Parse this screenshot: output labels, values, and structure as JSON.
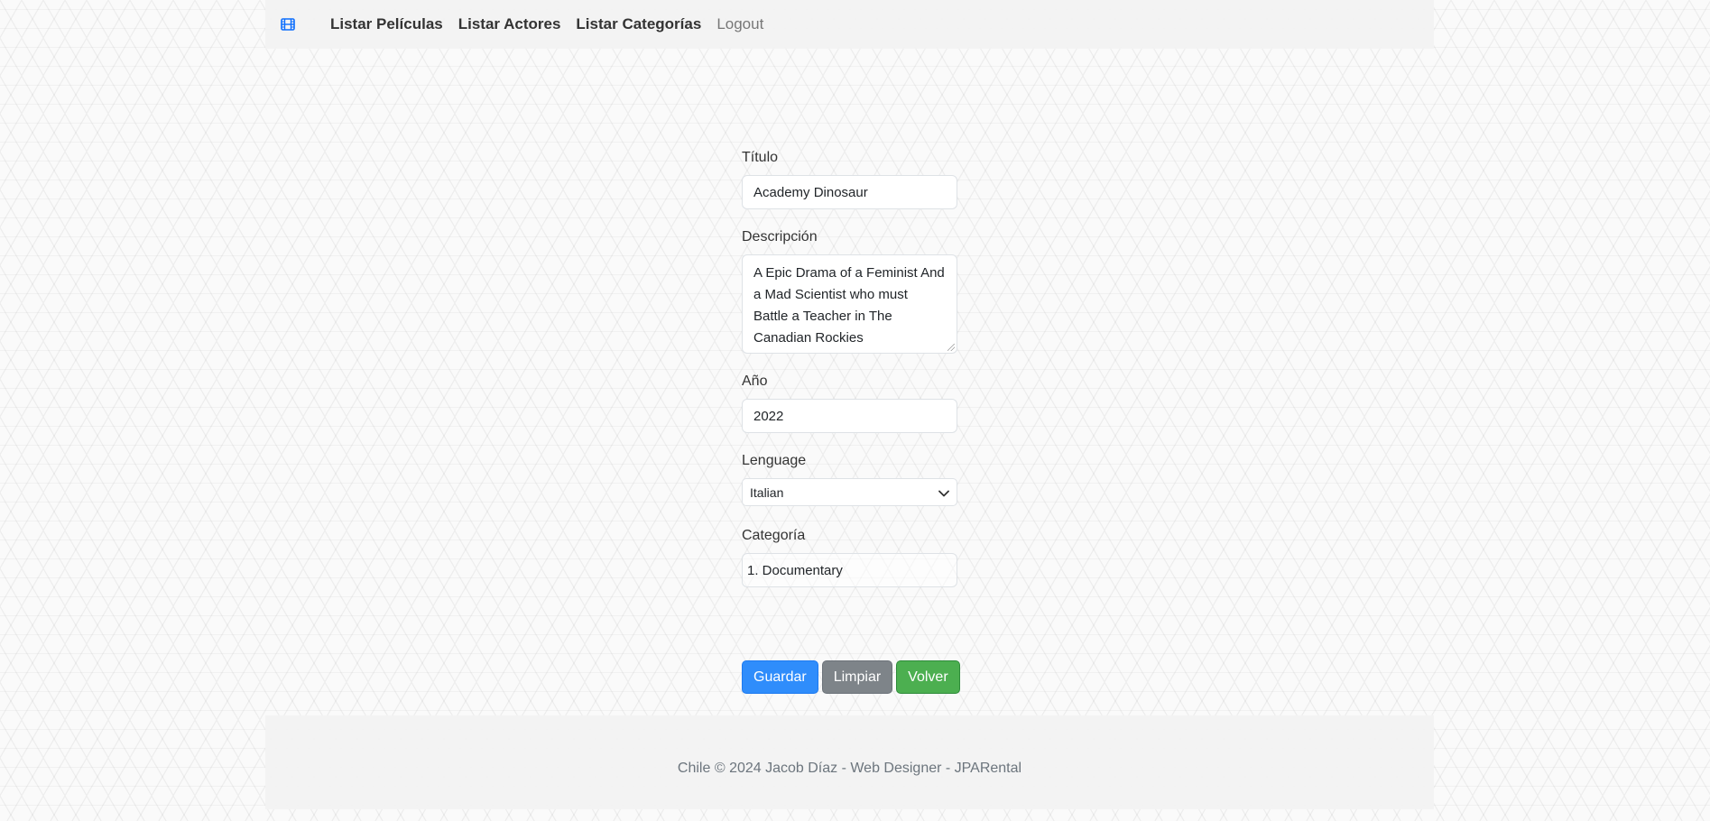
{
  "navbar": {
    "brand_icon": "film-icon",
    "links": [
      {
        "label": "Listar Películas"
      },
      {
        "label": "Listar Actores"
      },
      {
        "label": "Listar Categorías"
      },
      {
        "label": "Logout"
      }
    ]
  },
  "form": {
    "titulo": {
      "label": "Título",
      "value": "Academy Dinosaur"
    },
    "descripcion": {
      "label": "Descripción",
      "value": "A Epic Drama of a Feminist And a Mad Scientist who must Battle a Teacher in The Canadian Rockies"
    },
    "anio": {
      "label": "Año",
      "value": "2022"
    },
    "lenguaje": {
      "label": "Lenguage",
      "selected": "Italian"
    },
    "categoria": {
      "label": "Categoría",
      "value": "1. Documentary"
    }
  },
  "buttons": {
    "guardar": "Guardar",
    "limpiar": "Limpiar",
    "volver": "Volver"
  },
  "footer": {
    "text": "Chile © 2024 Jacob Díaz - Web Designer - JPARental"
  },
  "colors": {
    "primary": "#2f8dfb",
    "secondary": "#7e8489",
    "success": "#4caf50"
  }
}
